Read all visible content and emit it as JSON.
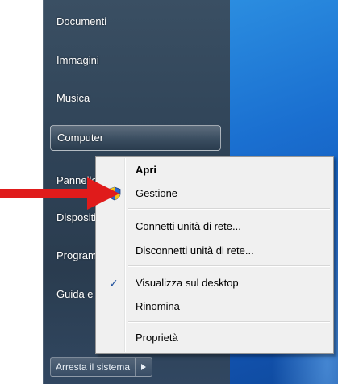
{
  "start_menu": {
    "items": [
      {
        "label": "Documenti"
      },
      {
        "label": "Immagini"
      },
      {
        "label": "Musica"
      },
      {
        "label": "Computer"
      },
      {
        "label": "Pannello di controllo"
      },
      {
        "label": "Dispositivi e stampanti"
      },
      {
        "label": "Programmi predefiniti"
      },
      {
        "label": "Guida e supporto tecnico"
      }
    ],
    "shutdown_label": "Arresta il sistema",
    "shutdown_arrow_icon": "triangle-right-icon"
  },
  "context_menu": {
    "items": [
      {
        "label": "Apri"
      },
      {
        "label": "Gestione",
        "icon": "uac-shield-icon"
      },
      {
        "label": "Connetti unità di rete..."
      },
      {
        "label": "Disconnetti unità di rete..."
      },
      {
        "label": "Visualizza sul desktop",
        "checked": true
      },
      {
        "label": "Rinomina"
      },
      {
        "label": "Proprietà"
      }
    ]
  },
  "annotation": {
    "icon": "red-arrow-icon",
    "color": "#e01b1b"
  }
}
